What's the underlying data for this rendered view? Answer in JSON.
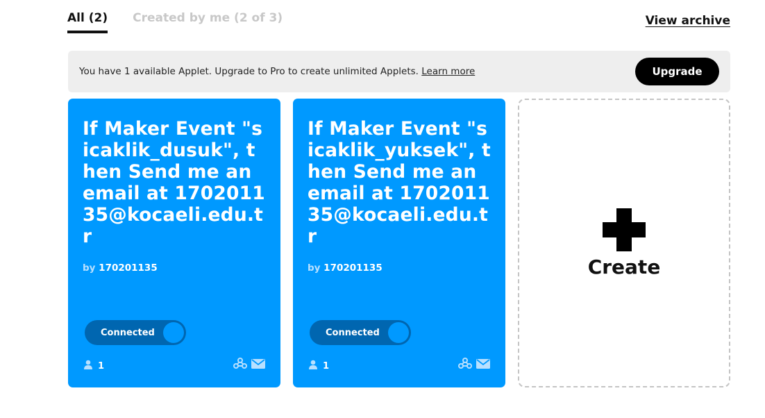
{
  "tabs": [
    {
      "label": "All (2)",
      "active": true
    },
    {
      "label": "Created by me (2 of 3)",
      "active": false
    }
  ],
  "archive_link": "View archive",
  "banner": {
    "text": "You have 1 available Applet. Upgrade to Pro to create unlimited Applets.",
    "link": "Learn more",
    "button": "Upgrade"
  },
  "applets": [
    {
      "title": "If Maker Event \"sicaklik_dusuk\", then Send me an email at 170201135@kocaeli.edu.tr",
      "by_label": "by",
      "author": "170201135",
      "status": "Connected",
      "users": "1",
      "icons": [
        "webhooks-icon",
        "email-icon"
      ]
    },
    {
      "title": "If Maker Event \"sicaklik_yuksek\", then Send me an email at 170201135@kocaeli.edu.tr",
      "by_label": "by",
      "author": "170201135",
      "status": "Connected",
      "users": "1",
      "icons": [
        "webhooks-icon",
        "email-icon"
      ]
    }
  ],
  "create": {
    "label": "Create",
    "icon": "plus-icon"
  },
  "colors": {
    "card": "#0099ff",
    "toggle": "#0066b0",
    "banner": "#eeeeee"
  }
}
